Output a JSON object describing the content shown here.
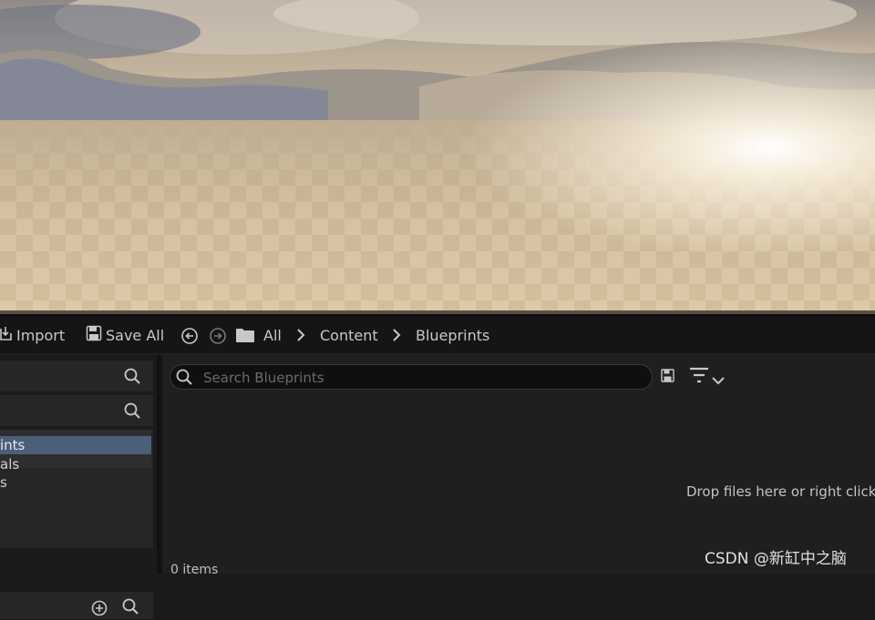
{
  "toolbar": {
    "import_label": "Import",
    "save_all_label": "Save All",
    "breadcrumb": [
      "All",
      "Content",
      "Blueprints"
    ]
  },
  "sources_panel": {
    "tree_items": [
      "ints",
      "als",
      "s"
    ]
  },
  "search": {
    "placeholder": "Search Blueprints"
  },
  "content_area": {
    "drop_hint": "Drop files here or right click",
    "items_count": "0 items"
  },
  "watermark": "CSDN @新缸中之脑",
  "colors": {
    "selection": "#4b5f7a",
    "panel": "#262626",
    "background": "#1f1f1f"
  }
}
